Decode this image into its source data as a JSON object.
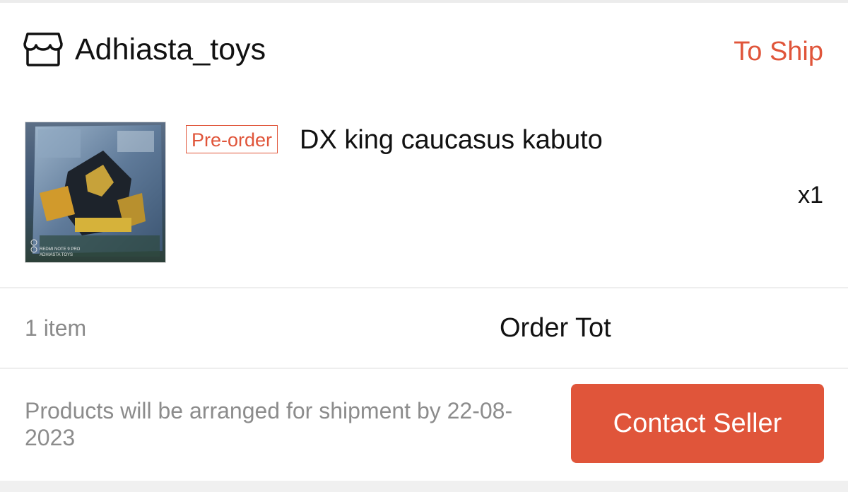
{
  "shop": {
    "name": "Adhiasta_toys",
    "icon": "store-icon",
    "status": "To Ship"
  },
  "product": {
    "badge": "Pre-order",
    "name": "DX king caucasus kabuto",
    "quantity": "x1",
    "image_caption": "REDMI NOTE 9 PRO\nADHIASTA TOYS"
  },
  "summary": {
    "item_count": "1 item",
    "order_total_label": "Order Tot"
  },
  "footer": {
    "ship_note": "Products will be arranged for shipment by 22-08-2023",
    "contact_button": "Contact Seller"
  },
  "colors": {
    "accent": "#e0553a",
    "muted_text": "#8a8a8a",
    "primary_text": "#111111"
  }
}
